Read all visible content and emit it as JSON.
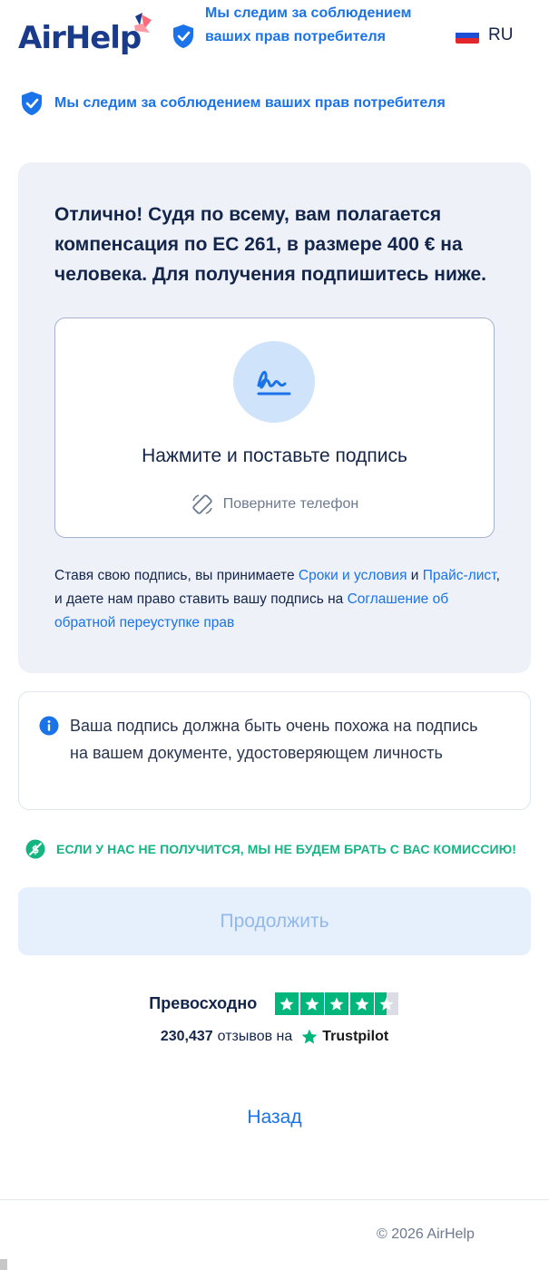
{
  "header": {
    "logo_text": "AirHelp",
    "trust_text": "Мы следим за соблюдением ваших прав потребителя",
    "language": "RU"
  },
  "trust_row": {
    "text": "Мы следим за соблюдением ваших прав потребителя"
  },
  "card": {
    "title": "Отлично! Судя по всему, вам полагается компенсация по ЕС 261, в размере 400 € на человека. Для получения подпишитесь ниже.",
    "sign_label": "Нажмите и поставьте подпись",
    "rotate_hint": "Поверните телефон",
    "terms": {
      "part1": "Ставя свою подпись, вы принимаете ",
      "link1": "Сроки и условия",
      "part2": " и ",
      "link2": "Прайс-лист",
      "part3": ", и даете нам право ставить вашу подпись на ",
      "link3": "Соглашение об обратной переуступке прав"
    }
  },
  "info": {
    "text": "Ваша подпись должна быть очень похожа на подпись на вашем документе, удостоверяющем личность"
  },
  "guarantee": {
    "text": "ЕСЛИ У НАС НЕ ПОЛУЧИТСЯ, МЫ НЕ БУДЕМ БРАТЬ С ВАС КОМИССИЮ!"
  },
  "continue_button": {
    "label": "Продолжить"
  },
  "rating": {
    "word": "Превосходно",
    "stars": 4.5,
    "review_count": "230,437",
    "reviews_on": "отзывов на",
    "platform": "Trustpilot"
  },
  "back_link": {
    "label": "Назад"
  },
  "footer": {
    "copyright": "© 2026 AirHelp"
  },
  "colors": {
    "brand_blue": "#1a73e8",
    "navy": "#14254b",
    "trustpilot_green": "#00b67a",
    "guarantee_green": "#15b583"
  }
}
